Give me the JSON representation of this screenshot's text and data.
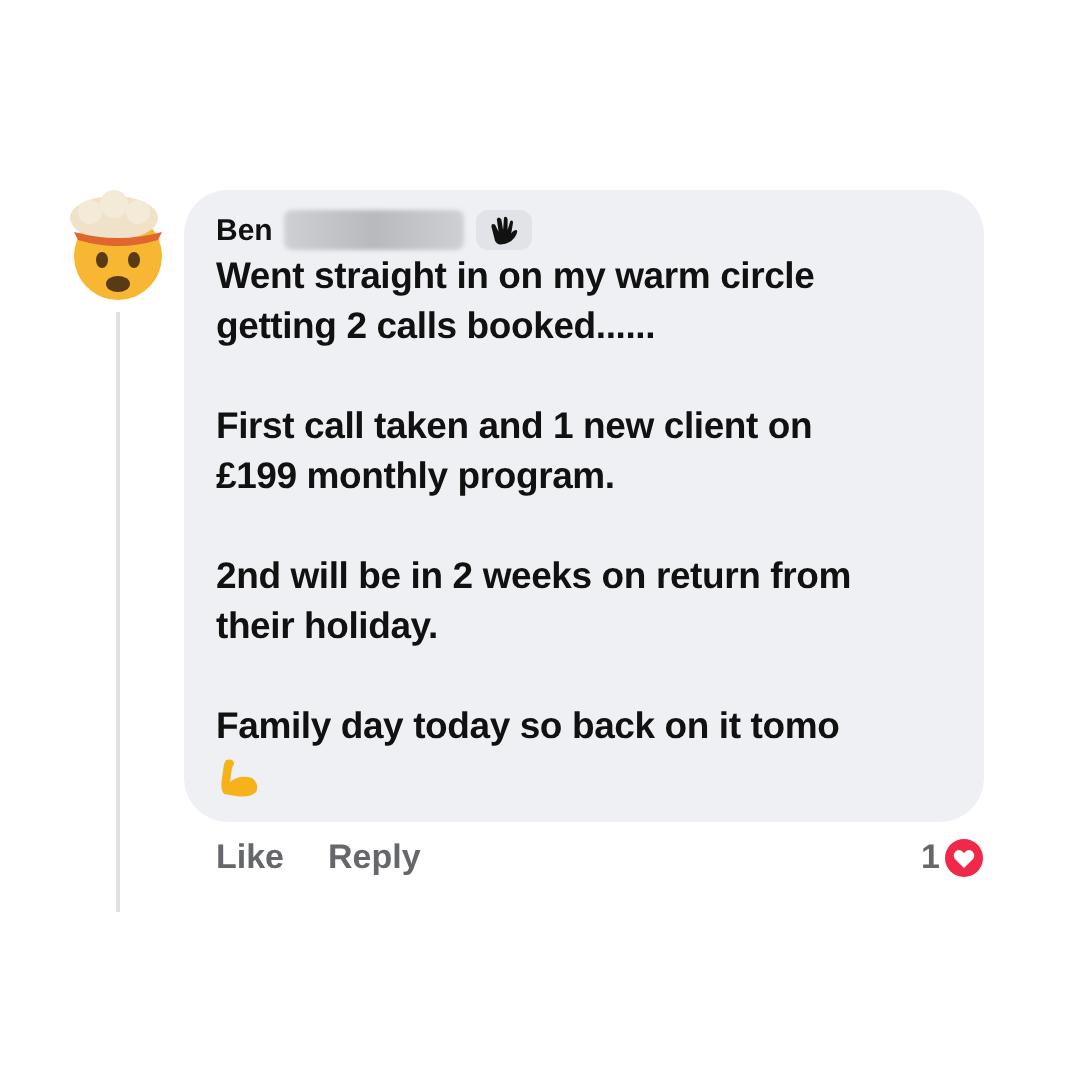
{
  "comment": {
    "author": "Ben",
    "name_redacted": true,
    "paragraphs": [
      "Went straight in on my warm circle getting 2 calls booked......",
      "First call taken and 1 new client on £199 monthly  program.",
      "2nd will be in 2 weeks on return from their holiday.",
      "Family day today so back on it tomo"
    ],
    "ends_with_flex_emoji": true,
    "actions": [
      {
        "label": "Like"
      },
      {
        "label": "Reply"
      }
    ],
    "reaction_count": "1"
  }
}
